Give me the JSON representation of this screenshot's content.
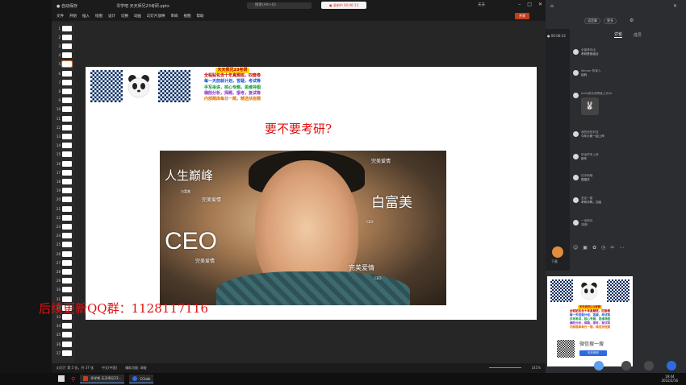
{
  "ppt": {
    "title": "寻学吧 天天师兄23考研.pptx",
    "search_placeholder": "搜索(Alt+Q)",
    "recording": "● 录制中 00:06:13",
    "user": "天天",
    "menu": [
      "文件",
      "开始",
      "插入",
      "绘图",
      "设计",
      "切换",
      "动画",
      "幻灯片放映",
      "审阅",
      "视图",
      "帮助"
    ],
    "share": "共享",
    "slide_numbers": [
      "1",
      "2",
      "3",
      "4",
      "5",
      "6",
      "7",
      "8",
      "9",
      "10",
      "11",
      "12",
      "13",
      "14",
      "15",
      "16",
      "17",
      "18",
      "19",
      "20",
      "21",
      "22",
      "23",
      "24",
      "25",
      "26",
      "27",
      "28",
      "29",
      "30",
      "31",
      "32",
      "33",
      "34",
      "35",
      "36",
      "37"
    ],
    "status_left": "幻灯片 第 5 张，共 37 张",
    "status_lang": "中文(中国)",
    "status_access": "辅助功能: 调查",
    "zoom": "141%"
  },
  "slide": {
    "promo_head": "天天师兄23考研",
    "promo_lines": [
      "全程贴包含十年真题班，四套卷",
      "每一天前就计划，答疑，考试等",
      "手写串讲，核心专题，思维导图",
      "横削分析，择题，报考，复试等",
      "内部题库每日一题，精选扶班题"
    ],
    "title": "要不要考研?",
    "photo_text": {
      "t1": "人生巅峰",
      "t1s": "白富美",
      "t2": "完美爱情",
      "t3": "白富美",
      "t3s": "CEO",
      "t4": "CEO",
      "t4s": "完美爱情",
      "t5": "完美爱情",
      "t5s": "CEO",
      "t6": "完美爱情"
    }
  },
  "watermark": "后续更新QQ群：1128117116",
  "meeting": {
    "timer": "● 00:06:13",
    "btn1": "语音聊",
    "btn2": "更多",
    "tabs": [
      "讨论",
      "成员"
    ],
    "messages": [
      {
        "name": "全能哥你出",
        "text": "考研是啥组合"
      },
      {
        "name": "Winner 陈某人",
        "text": "起码"
      },
      {
        "name": "hello老实说啊我上次2a",
        "text": ""
      },
      {
        "name": "我的西伯利亚",
        "text": "今年大家一起上岸"
      },
      {
        "name": "好运早来上岸",
        "text": "新年"
      },
      {
        "name": "在冲刺哦",
        "text": "猫猫关"
      },
      {
        "name": "坚定一路",
        "text": "考研冲鸭，加油"
      },
      {
        "name": "一米阳光",
        "text": "冲冲!"
      }
    ],
    "me_label": "下麦",
    "card": {
      "head": "天天师兄23考研",
      "lines": [
        "全程贴包含十年真题班，四套卷",
        "每一天前就计划，答疑，考试等",
        "手写串讲，核心专题，思维导图",
        "横削分析，择题，报考，复试等",
        "内部题库每日一题，精选扶班题"
      ],
      "wechat": "微信搜一搜",
      "btn": "天天师兄"
    }
  },
  "taskbar": {
    "tasks": [
      "寻学吧 天天师兄23...",
      "CCtalk"
    ],
    "time": "19:44",
    "date": "2022/2/16"
  }
}
